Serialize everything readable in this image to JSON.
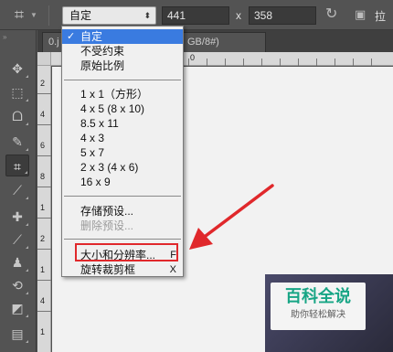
{
  "options_bar": {
    "ratio_value": "自定",
    "width_value": "441",
    "height_value": "358",
    "x_separator": "x",
    "straighten_label": "拉"
  },
  "document_tab": {
    "left_text": "0.j",
    "right_text": "GB/8#)"
  },
  "rulers": {
    "top": [
      "0"
    ],
    "left": [
      "2",
      "4",
      "6",
      "8",
      "1",
      "2",
      "1",
      "4",
      "1"
    ]
  },
  "menu": {
    "items": [
      {
        "label": "自定",
        "checked": true,
        "selected": true
      },
      {
        "label": "不受约束"
      },
      {
        "label": "原始比例"
      },
      {
        "label": "1 x 1（方形）"
      },
      {
        "label": "4 x 5 (8 x 10)"
      },
      {
        "label": "8.5 x 11"
      },
      {
        "label": "4 x 3"
      },
      {
        "label": "5 x 7"
      },
      {
        "label": "2 x 3 (4 x 6)"
      },
      {
        "label": "16 x 9"
      },
      {
        "label": "存储预设..."
      },
      {
        "label": "删除预设...",
        "disabled": true
      },
      {
        "label": "大小和分辨率...",
        "shortcut": "F"
      },
      {
        "label": "旋转裁剪框",
        "shortcut": "X"
      }
    ],
    "check_mark": "✓"
  },
  "watermark": {
    "title": "百科全说",
    "subtitle": "助你轻松解决"
  },
  "colors": {
    "highlight": "#e0282b",
    "selection": "#3a7be0",
    "watermark_green": "#17a585"
  },
  "icons": [
    "crop-icon",
    "move-icon",
    "marquee-icon",
    "lasso-icon",
    "quick-select-icon",
    "eyedropper-icon",
    "healing-icon",
    "brush-icon",
    "stamp-icon",
    "history-brush-icon",
    "eraser-icon",
    "gradient-icon",
    "swap-icon",
    "straighten-icon"
  ]
}
